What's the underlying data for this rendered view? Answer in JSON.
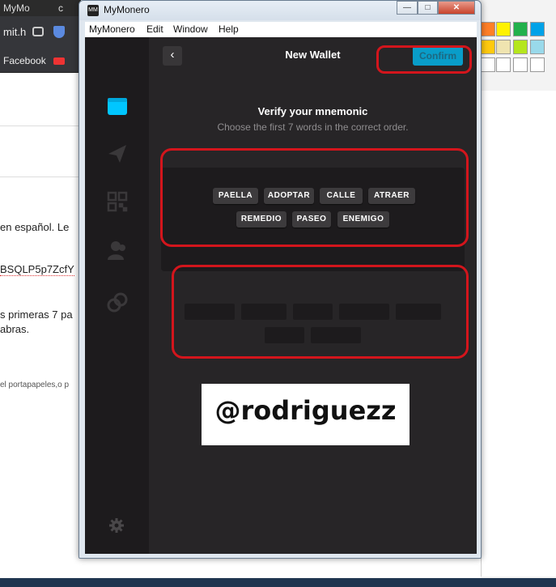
{
  "background_browser": {
    "tabs": [
      "MyMo",
      "c"
    ],
    "address_fragment": "mit.h",
    "bookmark": "Facebook",
    "doc_lines": [
      "en español. Le",
      "BSQLP5p7ZcfY",
      "s primeras 7 pa",
      "abras.",
      "el portapapeles,o p"
    ]
  },
  "window": {
    "title": "MyMonero",
    "icon_text": "MM",
    "controls": {
      "minimize": "—",
      "maximize": "□",
      "close": "✕"
    },
    "menu": [
      "MyMonero",
      "Edit",
      "Window",
      "Help"
    ]
  },
  "sidebar": {
    "items": [
      {
        "icon": "wallet-icon",
        "active": true
      },
      {
        "icon": "send-icon",
        "active": false
      },
      {
        "icon": "qr-code-icon",
        "active": false
      },
      {
        "icon": "contacts-icon",
        "active": false
      },
      {
        "icon": "exchange-icon",
        "active": false
      }
    ],
    "settings_icon": "gear-icon"
  },
  "navbar": {
    "back_glyph": "‹",
    "title": "New Wallet",
    "confirm_label": "Confirm"
  },
  "verify": {
    "title": "Verify your mnemonic",
    "subtitle": "Choose the first 7 words in the correct order."
  },
  "word_pool": {
    "row1": [
      "PAELLA",
      "ADOPTAR",
      "CALLE",
      "ATRAER"
    ],
    "row2": [
      "REMEDIO",
      "PASEO",
      "ENEMIGO"
    ]
  },
  "selection_slots": {
    "count": 7
  },
  "watermark": {
    "text": "@rodriguezz"
  },
  "colors": {
    "accent": "#00c6ff",
    "app_bg": "#272527",
    "sidebar_bg": "#1d1b1d",
    "annotation": "#d3151c"
  }
}
